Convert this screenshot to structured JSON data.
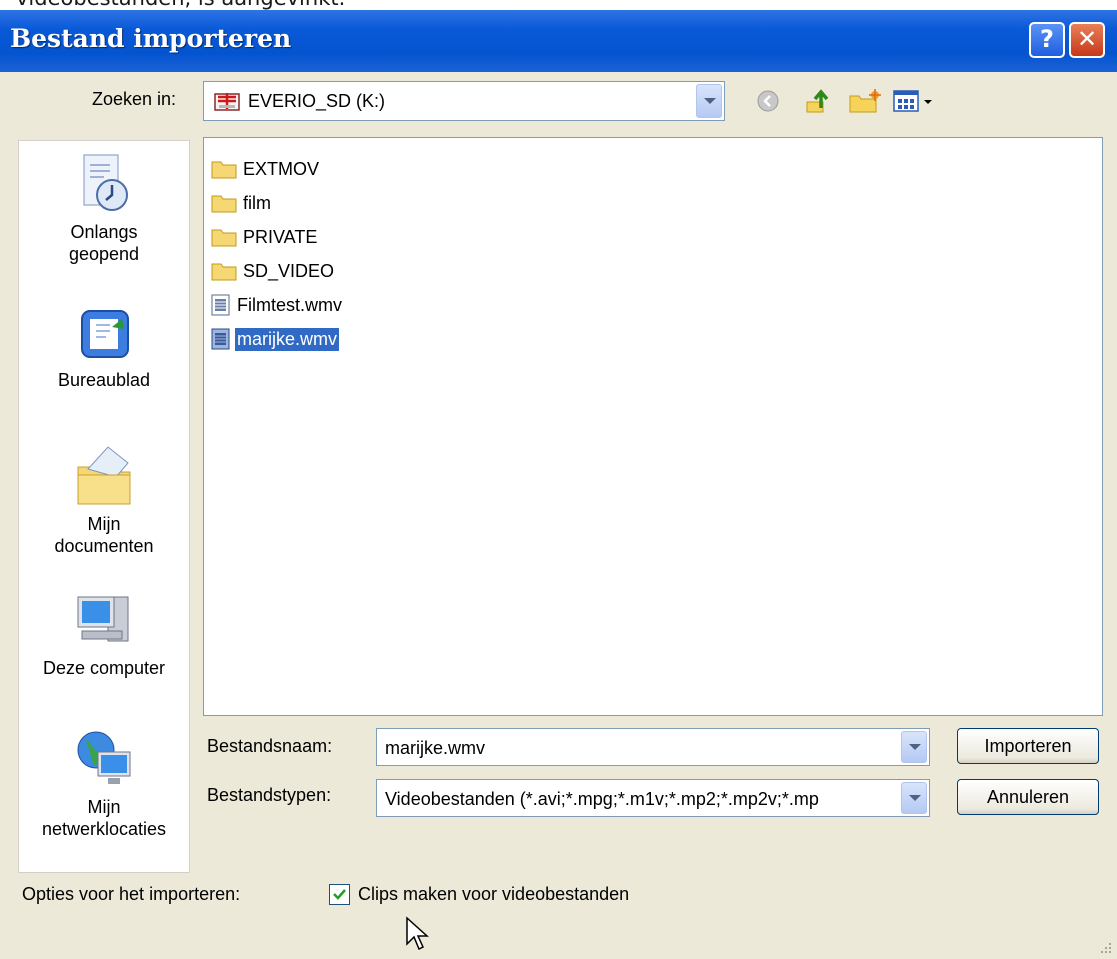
{
  "caption": "videobestanden, is aangevinkt.",
  "window": {
    "title": "Bestand importeren",
    "help_label": "?",
    "close_label": "✕"
  },
  "lookin": {
    "label": "Zoeken in:",
    "value": "EVERIO_SD (K:)"
  },
  "toolbar": {
    "icons": [
      "back-icon",
      "up-folder-icon",
      "new-folder-icon",
      "view-menu-icon"
    ]
  },
  "places": [
    {
      "label_lines": [
        "Onlangs",
        "geopend"
      ],
      "icon": "recent-icon"
    },
    {
      "label_lines": [
        "Bureaublad"
      ],
      "icon": "desktop-icon"
    },
    {
      "label_lines": [
        "Mijn",
        "documenten"
      ],
      "icon": "documents-icon"
    },
    {
      "label_lines": [
        "Deze computer"
      ],
      "icon": "computer-icon"
    },
    {
      "label_lines": [
        "Mijn",
        "netwerklocaties"
      ],
      "icon": "network-icon"
    }
  ],
  "files": [
    {
      "name": "EXTMOV",
      "type": "folder"
    },
    {
      "name": "film",
      "type": "folder"
    },
    {
      "name": "PRIVATE",
      "type": "folder"
    },
    {
      "name": "SD_VIDEO",
      "type": "folder"
    },
    {
      "name": "Filmtest.wmv",
      "type": "video"
    },
    {
      "name": "marijke.wmv",
      "type": "video",
      "selected": true
    }
  ],
  "filename": {
    "label": "Bestandsnaam:",
    "value": "marijke.wmv"
  },
  "filetype": {
    "label": "Bestandstypen:",
    "value": "Videobestanden (*.avi;*.mpg;*.m1v;*.mp2;*.mp2v;*.mp"
  },
  "buttons": {
    "import": "Importeren",
    "cancel": "Annuleren"
  },
  "options": {
    "label": "Opties voor het importeren:",
    "checkbox_label": "Clips maken voor videobestanden",
    "checked": true
  },
  "colors": {
    "titlebar": "#0454d0",
    "selection": "#316ac5",
    "dialog_bg": "#ece9d8"
  }
}
